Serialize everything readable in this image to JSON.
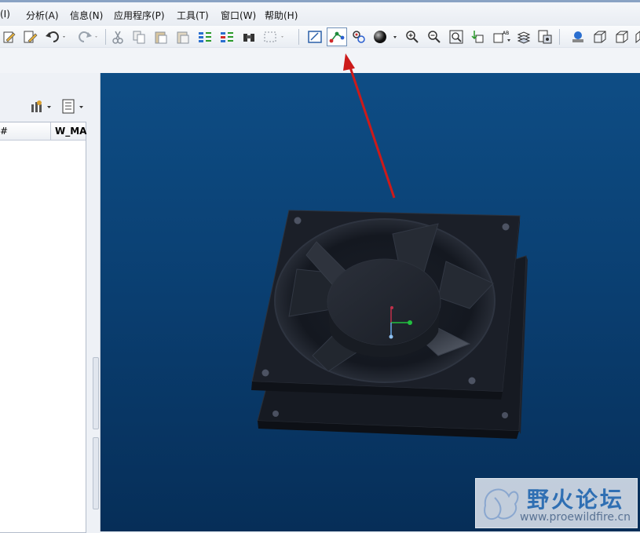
{
  "menu": {
    "items": [
      {
        "label": "(I)"
      },
      {
        "label": "分析(A)"
      },
      {
        "label": "信息(N)"
      },
      {
        "label": "应用程序(P)"
      },
      {
        "label": "工具(T)"
      },
      {
        "label": "窗口(W)"
      },
      {
        "label": "帮助(H)"
      }
    ]
  },
  "toolbar": {
    "buttons": [
      {
        "icon": "regenerate-icon"
      },
      {
        "icon": "edit-definition-icon"
      },
      {
        "icon": "undo-icon"
      },
      {
        "icon": "redo-icon"
      },
      {
        "icon": "cut-icon"
      },
      {
        "icon": "copy-icon"
      },
      {
        "icon": "paste-icon"
      },
      {
        "icon": "paste-special-icon"
      },
      {
        "icon": "regenerate-manager-icon"
      },
      {
        "icon": "regenerate-all-icon"
      },
      {
        "icon": "find-icon"
      },
      {
        "icon": "select-box-icon"
      },
      {
        "icon": "repaint-icon"
      },
      {
        "icon": "spin-center-icon",
        "active": true
      },
      {
        "icon": "orient-mode-icon"
      },
      {
        "icon": "display-style-icon"
      },
      {
        "icon": "zoom-in-icon"
      },
      {
        "icon": "zoom-out-icon"
      },
      {
        "icon": "refit-icon"
      },
      {
        "icon": "reorient-icon"
      },
      {
        "icon": "saved-views-icon"
      },
      {
        "icon": "layers-icon"
      },
      {
        "icon": "view-manager-icon"
      },
      {
        "icon": "appearance-icon"
      },
      {
        "icon": "wireframe-icon"
      },
      {
        "icon": "hidden-line-icon"
      }
    ]
  },
  "tree": {
    "col1": "#",
    "col2": "W_MA"
  },
  "watermark": {
    "title": "野火论坛",
    "url": "www.proewildfire.cn"
  },
  "colors": {
    "viewport_top": "#0e4d85",
    "viewport_bottom": "#062e58",
    "annotation_arrow": "#cc1a1a",
    "fan_body": "#1b1f28"
  }
}
